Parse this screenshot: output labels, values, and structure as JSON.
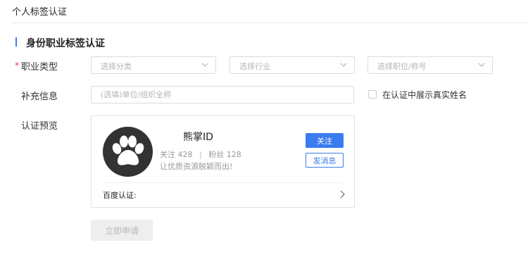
{
  "page": {
    "title": "个人标签认证"
  },
  "section": {
    "title": "身份职业标签认证"
  },
  "form": {
    "occupation": {
      "label": "职业类型",
      "required_mark": "*",
      "category_placeholder": "选择分类",
      "industry_placeholder": "选择行业",
      "position_placeholder": "选择职位/称号"
    },
    "extra": {
      "label": "补充信息",
      "placeholder": "(选填)单位/组织全称"
    },
    "show_real_name": {
      "label": "在认证中展示真实姓名",
      "checked": false
    },
    "preview": {
      "label": "认证预览"
    }
  },
  "preview_card": {
    "name": "熊掌ID",
    "follow_label": "关注",
    "follow_count": "428",
    "fans_label": "粉丝",
    "fans_count": "128",
    "separator": "|",
    "slogan": "让优质资源脱颖而出!",
    "follow_button": "关注",
    "message_button": "发消息",
    "cert_label": "百度认证:",
    "avatar_icon": "paw-icon"
  },
  "actions": {
    "apply_label": "立即申请"
  },
  "colors": {
    "accent": "#3a7cf0",
    "required": "#e4393c",
    "avatar_bg": "#333333"
  }
}
